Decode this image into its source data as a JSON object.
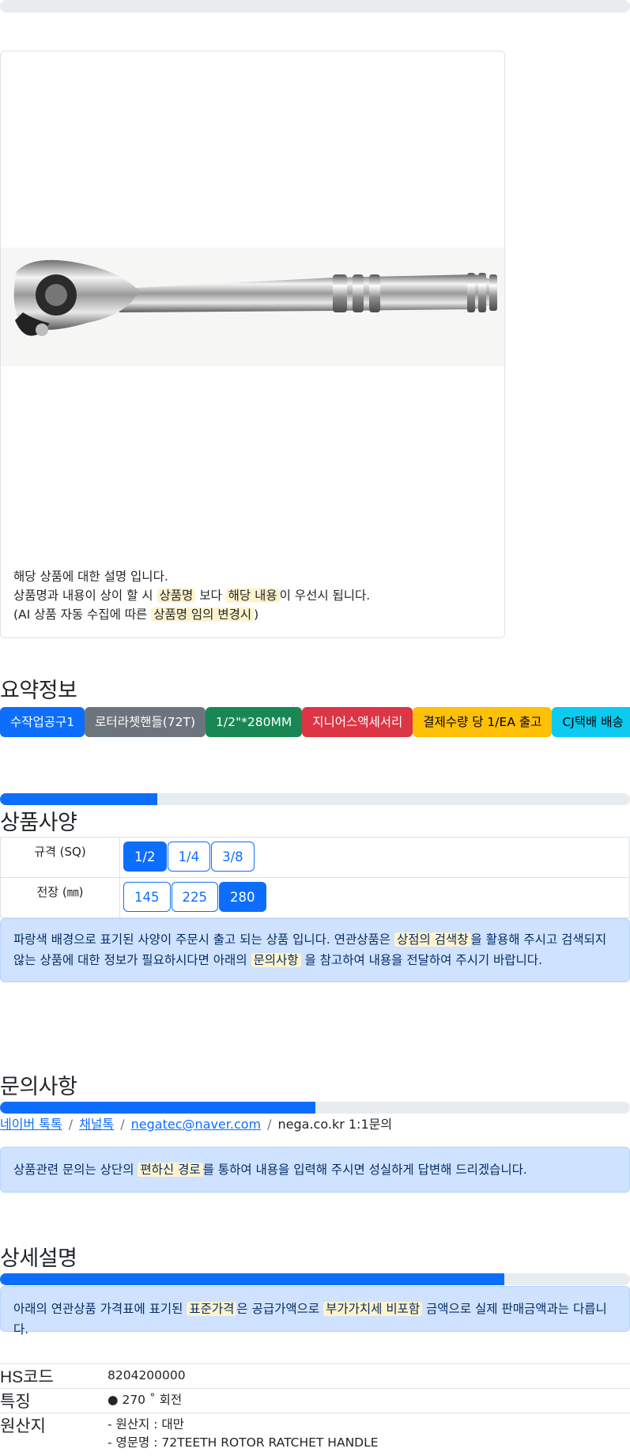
{
  "top_progress": {
    "percent": 0
  },
  "product": {
    "desc_line1": "해당 상품에 대한 설명 입니다.",
    "desc_line2_a": "상품명과 내용이 상이 할 시 ",
    "desc_line2_hl1": "상품명",
    "desc_line2_b": " 보다 ",
    "desc_line2_hl2": "해당 내용",
    "desc_line2_c": "이 우선시 됩니다.",
    "desc_line3_a": "(AI 상품 자동 수집에 따른 ",
    "desc_line3_hl": "상품명 임의 변경시",
    "desc_line3_b": ")"
  },
  "summary": {
    "title": "요약정보",
    "chips": [
      {
        "label": "수작업공구1",
        "bg": "#0d6efd",
        "fg": "#ffffff"
      },
      {
        "label": "로터라쳇핸들(72T)",
        "bg": "#6c757d",
        "fg": "#ffffff"
      },
      {
        "label": "1/2\"*280MM",
        "bg": "#198754",
        "fg": "#ffffff"
      },
      {
        "label": "지니어스액세서리",
        "bg": "#dc3545",
        "fg": "#ffffff"
      },
      {
        "label": "결제수량 당 1/EA 출고",
        "bg": "#ffc107",
        "fg": "#000000"
      },
      {
        "label": "CJ택배 배송",
        "bg": "#0dcaf0",
        "fg": "#000000"
      }
    ]
  },
  "spec": {
    "title": "상품사양",
    "progress_percent": 25,
    "rows": [
      {
        "label": "규격 (SQ)",
        "options": [
          "1/2",
          "1/4",
          "3/8"
        ],
        "selected": 0
      },
      {
        "label": "전장 (㎜)",
        "options": [
          "145",
          "225",
          "280"
        ],
        "selected": 2
      }
    ],
    "notice_a": "파랑색 배경으로 표기된 사양이 주문시 출고 되는 상품 입니다. 연관상품은 ",
    "notice_hl1": "상점의 검색창",
    "notice_b": "을 활용해 주시고 검색되지 않는 상품에 대한 정보가 필요하시다면 아래의 ",
    "notice_hl2": "문의사항",
    "notice_c": " 을 참고하여 내용을 전달하여 주시기 바랍니다."
  },
  "inquiry": {
    "title": "문의사항",
    "progress_percent": 50,
    "links": [
      "네이버 톡톡",
      "채널톡",
      "negatec@naver.com"
    ],
    "sep": "/",
    "plain": "nega.co.kr 1:1문의",
    "notice_a": "상품관련 문의는 상단의 ",
    "notice_hl": "편하신 경로",
    "notice_b": "를 통하여 내용을 입력해 주시면 성실하게 답변해 드리겠습니다."
  },
  "detail": {
    "title": "상세설명",
    "progress_percent": 80,
    "notice_a": "아래의 연관상품 가격표에 표기된 ",
    "notice_hl1": "표준가격",
    "notice_b": "은 공급가액으로 ",
    "notice_hl2": "부가가치세 비포함",
    "notice_c": " 금액으로 실제 판매금액과는 다릅니다.",
    "rows": [
      {
        "key": "HS코드",
        "lines": [
          "8204200000"
        ]
      },
      {
        "key": "특징",
        "lines": [
          "● 270 ˚ 회전"
        ]
      },
      {
        "key": "원산지",
        "lines": [
          "- 원산지 : 대만",
          "- 영문명 : 72TEETH ROTOR RATCHET HANDLE"
        ]
      }
    ]
  }
}
